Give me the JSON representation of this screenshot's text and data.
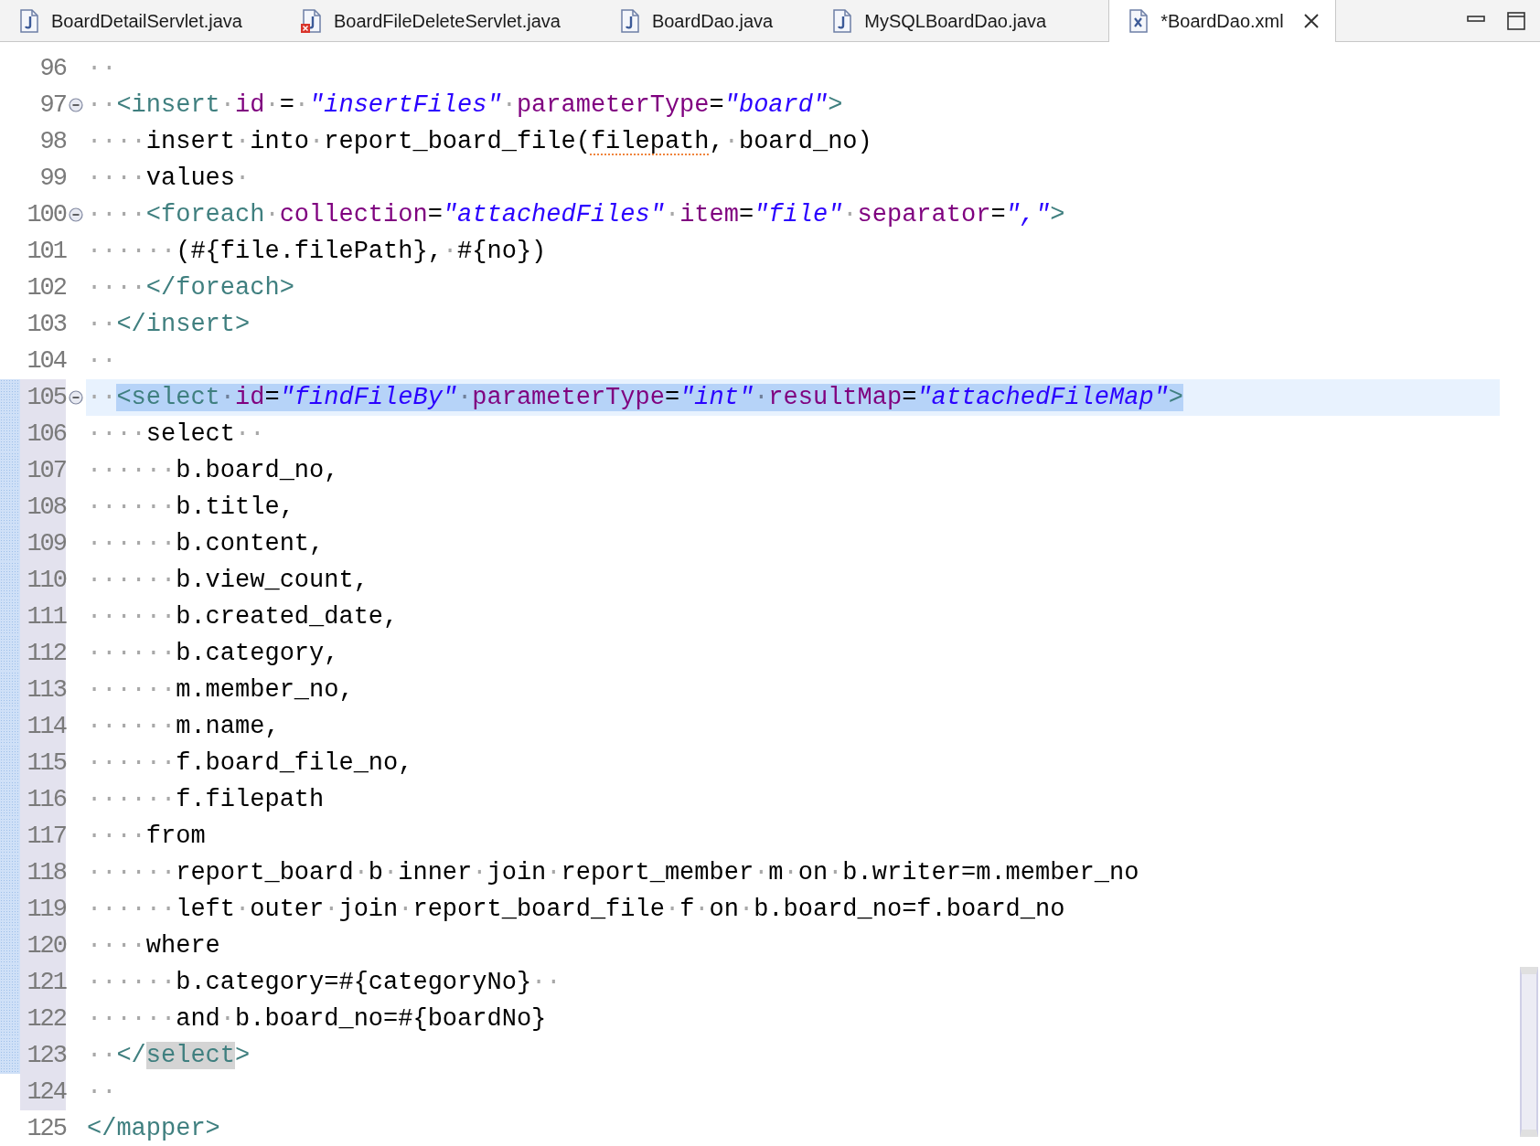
{
  "tabs": [
    {
      "kind": "java",
      "label": "BoardDetailServlet.java",
      "selected": false
    },
    {
      "kind": "java-error",
      "label": "BoardFileDeleteServlet.java",
      "selected": false
    },
    {
      "kind": "java",
      "label": "BoardDao.java",
      "selected": false
    },
    {
      "kind": "java",
      "label": "MySQLBoardDao.java",
      "selected": false
    },
    {
      "kind": "xml",
      "label": "*BoardDao.xml",
      "selected": true
    }
  ],
  "editor": {
    "lines": [
      {
        "number": "96",
        "foldable": false,
        "current": false,
        "selected": false,
        "ranged": false,
        "changed": false,
        "tokens": [
          {
            "kind": "indent",
            "text": "··"
          }
        ]
      },
      {
        "number": "97",
        "foldable": true,
        "current": false,
        "selected": false,
        "ranged": false,
        "changed": false,
        "tokens": [
          {
            "kind": "indent",
            "text": "··"
          },
          {
            "kind": "tag",
            "text": "<insert"
          },
          {
            "kind": "text",
            "text": "·"
          },
          {
            "kind": "attr",
            "text": "id"
          },
          {
            "kind": "text",
            "text": "·=·"
          },
          {
            "kind": "string",
            "text": "\"insertFiles\""
          },
          {
            "kind": "text",
            "text": "·"
          },
          {
            "kind": "attr",
            "text": "parameterType"
          },
          {
            "kind": "text",
            "text": "="
          },
          {
            "kind": "string",
            "text": "\"board\""
          },
          {
            "kind": "tag",
            "text": ">"
          }
        ]
      },
      {
        "number": "98",
        "foldable": false,
        "current": false,
        "selected": false,
        "ranged": false,
        "changed": false,
        "tokens": [
          {
            "kind": "indent",
            "text": "····"
          },
          {
            "kind": "text",
            "text": "insert·into·report_board_file("
          },
          {
            "kind": "typo",
            "text": "filepath"
          },
          {
            "kind": "text",
            "text": ",·board_no)"
          }
        ]
      },
      {
        "number": "99",
        "foldable": false,
        "current": false,
        "selected": false,
        "ranged": false,
        "changed": false,
        "tokens": [
          {
            "kind": "indent",
            "text": "····"
          },
          {
            "kind": "text",
            "text": "values·"
          }
        ]
      },
      {
        "number": "100",
        "foldable": true,
        "current": false,
        "selected": false,
        "ranged": false,
        "changed": false,
        "tokens": [
          {
            "kind": "indent",
            "text": "····"
          },
          {
            "kind": "tag",
            "text": "<foreach"
          },
          {
            "kind": "text",
            "text": "·"
          },
          {
            "kind": "attr",
            "text": "collection"
          },
          {
            "kind": "text",
            "text": "="
          },
          {
            "kind": "string",
            "text": "\"attachedFiles\""
          },
          {
            "kind": "text",
            "text": "·"
          },
          {
            "kind": "attr",
            "text": "item"
          },
          {
            "kind": "text",
            "text": "="
          },
          {
            "kind": "string",
            "text": "\"file\""
          },
          {
            "kind": "text",
            "text": "·"
          },
          {
            "kind": "attr",
            "text": "separator"
          },
          {
            "kind": "text",
            "text": "="
          },
          {
            "kind": "string",
            "text": "\",\""
          },
          {
            "kind": "tag",
            "text": ">"
          }
        ]
      },
      {
        "number": "101",
        "foldable": false,
        "current": false,
        "selected": false,
        "ranged": false,
        "changed": false,
        "tokens": [
          {
            "kind": "indent",
            "text": "······"
          },
          {
            "kind": "text",
            "text": "(#{file.filePath},·#{no})"
          }
        ]
      },
      {
        "number": "102",
        "foldable": false,
        "current": false,
        "selected": false,
        "ranged": false,
        "changed": false,
        "tokens": [
          {
            "kind": "indent",
            "text": "····"
          },
          {
            "kind": "tag",
            "text": "</foreach>"
          }
        ]
      },
      {
        "number": "103",
        "foldable": false,
        "current": false,
        "selected": false,
        "ranged": false,
        "changed": false,
        "tokens": [
          {
            "kind": "indent",
            "text": "··"
          },
          {
            "kind": "tag",
            "text": "</insert>"
          }
        ]
      },
      {
        "number": "104",
        "foldable": false,
        "current": false,
        "selected": false,
        "ranged": false,
        "changed": false,
        "tokens": [
          {
            "kind": "indent",
            "text": "··"
          }
        ]
      },
      {
        "number": "105",
        "foldable": true,
        "current": true,
        "selected": true,
        "ranged": true,
        "changed": true,
        "tokens": [
          {
            "kind": "indent",
            "text": "··"
          },
          {
            "kind": "tag",
            "text": "<select"
          },
          {
            "kind": "text",
            "text": "·"
          },
          {
            "kind": "attr",
            "text": "id"
          },
          {
            "kind": "text",
            "text": "="
          },
          {
            "kind": "string",
            "text": "\"findFileBy\""
          },
          {
            "kind": "text",
            "text": "·"
          },
          {
            "kind": "attr",
            "text": "parameterType"
          },
          {
            "kind": "text",
            "text": "="
          },
          {
            "kind": "string",
            "text": "\"int\""
          },
          {
            "kind": "text",
            "text": "·"
          },
          {
            "kind": "attr",
            "text": "resultMap"
          },
          {
            "kind": "text",
            "text": "="
          },
          {
            "kind": "string",
            "text": "\"attachedFileMap\""
          },
          {
            "kind": "tag",
            "text": ">"
          }
        ]
      },
      {
        "number": "106",
        "foldable": false,
        "current": false,
        "selected": false,
        "ranged": true,
        "changed": true,
        "tokens": [
          {
            "kind": "indent",
            "text": "····"
          },
          {
            "kind": "text",
            "text": "select··"
          }
        ]
      },
      {
        "number": "107",
        "foldable": false,
        "current": false,
        "selected": false,
        "ranged": true,
        "changed": true,
        "tokens": [
          {
            "kind": "indent",
            "text": "······"
          },
          {
            "kind": "text",
            "text": "b.board_no,"
          }
        ]
      },
      {
        "number": "108",
        "foldable": false,
        "current": false,
        "selected": false,
        "ranged": true,
        "changed": true,
        "tokens": [
          {
            "kind": "indent",
            "text": "······"
          },
          {
            "kind": "text",
            "text": "b.title,"
          }
        ]
      },
      {
        "number": "109",
        "foldable": false,
        "current": false,
        "selected": false,
        "ranged": true,
        "changed": true,
        "tokens": [
          {
            "kind": "indent",
            "text": "······"
          },
          {
            "kind": "text",
            "text": "b.content,"
          }
        ]
      },
      {
        "number": "110",
        "foldable": false,
        "current": false,
        "selected": false,
        "ranged": true,
        "changed": true,
        "tokens": [
          {
            "kind": "indent",
            "text": "······"
          },
          {
            "kind": "text",
            "text": "b.view_count,"
          }
        ]
      },
      {
        "number": "111",
        "foldable": false,
        "current": false,
        "selected": false,
        "ranged": true,
        "changed": true,
        "tokens": [
          {
            "kind": "indent",
            "text": "······"
          },
          {
            "kind": "text",
            "text": "b.created_date,"
          }
        ]
      },
      {
        "number": "112",
        "foldable": false,
        "current": false,
        "selected": false,
        "ranged": true,
        "changed": true,
        "tokens": [
          {
            "kind": "indent",
            "text": "······"
          },
          {
            "kind": "text",
            "text": "b.category,"
          }
        ]
      },
      {
        "number": "113",
        "foldable": false,
        "current": false,
        "selected": false,
        "ranged": true,
        "changed": true,
        "tokens": [
          {
            "kind": "indent",
            "text": "······"
          },
          {
            "kind": "text",
            "text": "m.member_no,"
          }
        ]
      },
      {
        "number": "114",
        "foldable": false,
        "current": false,
        "selected": false,
        "ranged": true,
        "changed": true,
        "tokens": [
          {
            "kind": "indent",
            "text": "······"
          },
          {
            "kind": "text",
            "text": "m.name,"
          }
        ]
      },
      {
        "number": "115",
        "foldable": false,
        "current": false,
        "selected": false,
        "ranged": true,
        "changed": true,
        "tokens": [
          {
            "kind": "indent",
            "text": "······"
          },
          {
            "kind": "text",
            "text": "f.board_file_no,"
          }
        ]
      },
      {
        "number": "116",
        "foldable": false,
        "current": false,
        "selected": false,
        "ranged": true,
        "changed": true,
        "tokens": [
          {
            "kind": "indent",
            "text": "······"
          },
          {
            "kind": "text",
            "text": "f.filepath"
          }
        ]
      },
      {
        "number": "117",
        "foldable": false,
        "current": false,
        "selected": false,
        "ranged": true,
        "changed": true,
        "tokens": [
          {
            "kind": "indent",
            "text": "····"
          },
          {
            "kind": "text",
            "text": "from"
          }
        ]
      },
      {
        "number": "118",
        "foldable": false,
        "current": false,
        "selected": false,
        "ranged": true,
        "changed": true,
        "tokens": [
          {
            "kind": "indent",
            "text": "······"
          },
          {
            "kind": "text",
            "text": "report_board·b·inner·join·report_member·m·on·b.writer=m.member_no"
          }
        ]
      },
      {
        "number": "119",
        "foldable": false,
        "current": false,
        "selected": false,
        "ranged": true,
        "changed": true,
        "tokens": [
          {
            "kind": "indent",
            "text": "······"
          },
          {
            "kind": "text",
            "text": "left·outer·join·report_board_file·f·on·b.board_no=f.board_no"
          }
        ]
      },
      {
        "number": "120",
        "foldable": false,
        "current": false,
        "selected": false,
        "ranged": true,
        "changed": true,
        "tokens": [
          {
            "kind": "indent",
            "text": "····"
          },
          {
            "kind": "text",
            "text": "where"
          }
        ]
      },
      {
        "number": "121",
        "foldable": false,
        "current": false,
        "selected": false,
        "ranged": true,
        "changed": true,
        "tokens": [
          {
            "kind": "indent",
            "text": "······"
          },
          {
            "kind": "text",
            "text": "b.category=#{categoryNo}··"
          }
        ]
      },
      {
        "number": "122",
        "foldable": false,
        "current": false,
        "selected": false,
        "ranged": true,
        "changed": true,
        "tokens": [
          {
            "kind": "indent",
            "text": "······"
          },
          {
            "kind": "text",
            "text": "and·b.board_no=#{boardNo}"
          }
        ]
      },
      {
        "number": "123",
        "foldable": false,
        "current": false,
        "selected": false,
        "ranged": true,
        "changed": true,
        "tokens": [
          {
            "kind": "indent",
            "text": "··"
          },
          {
            "kind": "tag",
            "text": "</"
          },
          {
            "kind": "match",
            "text": "select"
          },
          {
            "kind": "tag",
            "text": ">"
          }
        ]
      },
      {
        "number": "124",
        "foldable": false,
        "current": false,
        "selected": false,
        "ranged": true,
        "changed": false,
        "tokens": [
          {
            "kind": "indent",
            "text": "··"
          }
        ]
      },
      {
        "number": "125",
        "foldable": false,
        "current": false,
        "selected": false,
        "ranged": false,
        "changed": false,
        "tokens": [
          {
            "kind": "tag",
            "text": "</mapper>"
          }
        ]
      }
    ]
  }
}
